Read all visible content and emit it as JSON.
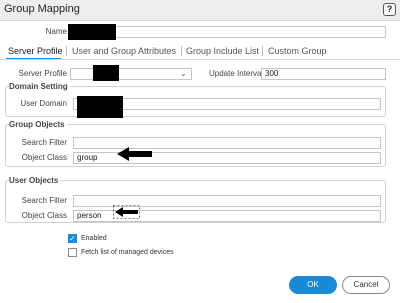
{
  "dialog": {
    "title": "Group Mapping",
    "help_icon": "question-icon",
    "help_label": "?"
  },
  "name": {
    "label": "Name",
    "value": ""
  },
  "tabs": [
    {
      "label": "Server Profile",
      "active": true
    },
    {
      "label": "User and Group Attributes",
      "active": false
    },
    {
      "label": "Group Include List",
      "active": false
    },
    {
      "label": "Custom Group",
      "active": false
    }
  ],
  "server_profile": {
    "label": "Server Profile",
    "value": "",
    "dropdown_icon": "chevron-down-icon",
    "update_interval_label": "Update Interval",
    "update_interval_value": "300"
  },
  "domain_setting": {
    "legend": "Domain Setting",
    "user_domain_label": "User Domain",
    "user_domain_value": ""
  },
  "group_objects": {
    "legend": "Group Objects",
    "search_filter_label": "Search Filter",
    "search_filter_value": "",
    "object_class_label": "Object Class",
    "object_class_value": "group"
  },
  "user_objects": {
    "legend": "User Objects",
    "search_filter_label": "Search Filter",
    "search_filter_value": "",
    "object_class_label": "Object Class",
    "object_class_value": "person"
  },
  "options": {
    "enabled_label": "Enabled",
    "enabled_checked": true,
    "fetch_label": "Fetch list of managed devices",
    "fetch_checked": false
  },
  "buttons": {
    "ok": "OK",
    "cancel": "Cancel"
  },
  "colors": {
    "accent": "#1a8ad4",
    "redaction": "#000000"
  }
}
